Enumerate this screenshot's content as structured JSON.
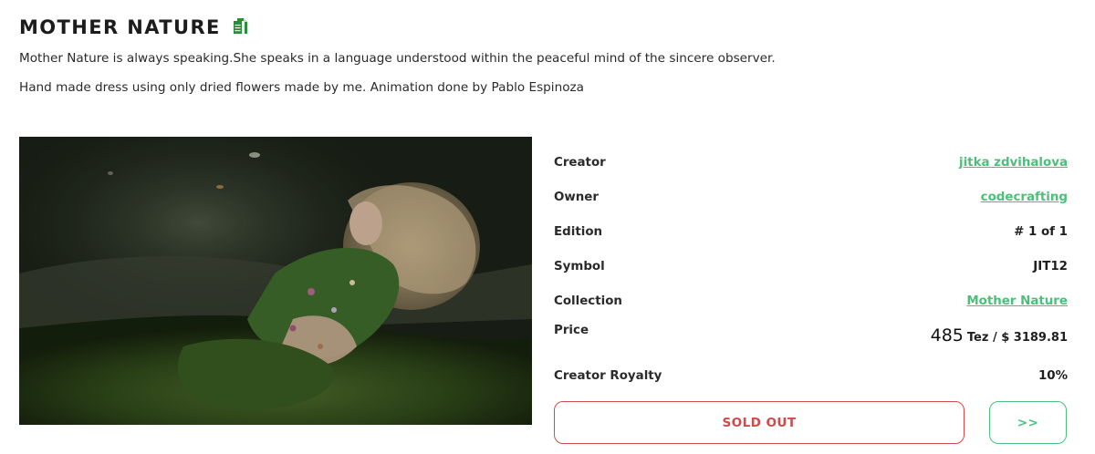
{
  "header": {
    "title": "MOTHER NATURE",
    "copy_icon": "copy-icon"
  },
  "description": {
    "line1": "Mother Nature is always speaking.She speaks in a language understood within the peaceful mind of the sincere observer.",
    "line2": "Hand made dress using only dried flowers made by me. Animation done by Pablo Espinoza"
  },
  "details": {
    "creator": {
      "label": "Creator",
      "value": "jitka zdvihalova"
    },
    "owner": {
      "label": "Owner",
      "value": "codecrafting"
    },
    "edition": {
      "label": "Edition",
      "value": "# 1 of 1"
    },
    "symbol": {
      "label": "Symbol",
      "value": "JIT12"
    },
    "collection": {
      "label": "Collection",
      "value": "Mother Nature"
    },
    "price": {
      "label": "Price",
      "amount": "485",
      "rest": "Tez / $ 3189.81"
    },
    "royalty": {
      "label": "Creator Royalty",
      "value": "10%"
    }
  },
  "actions": {
    "sold_out_label": "SOLD OUT",
    "next_label": ">>"
  },
  "colors": {
    "accent_green": "#4cc07a",
    "sold_red": "#cf4a4a",
    "icon_green": "#2e8b3a"
  }
}
